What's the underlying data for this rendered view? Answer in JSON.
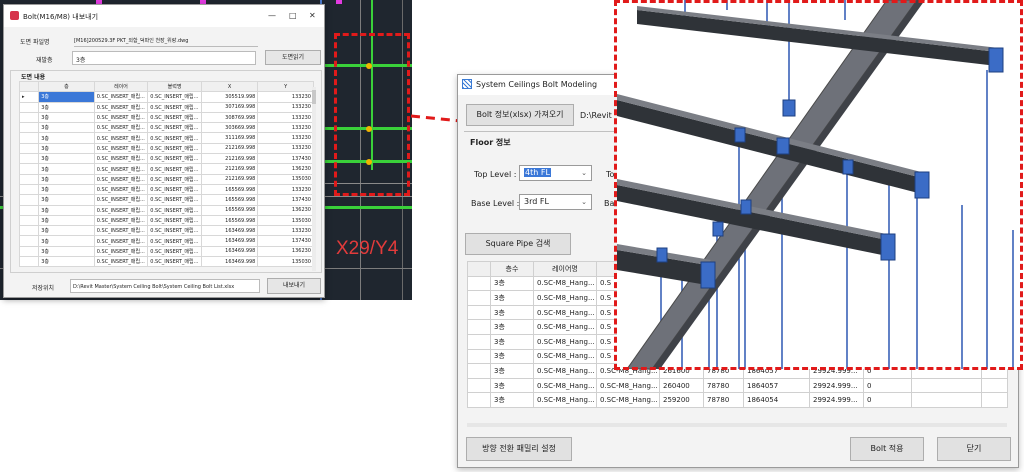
{
  "cad": {
    "label": "X29/Y4"
  },
  "export_window": {
    "title": "Bolt(M16/M8) 내보내기",
    "file_label": "도면 파일명",
    "file_value": "[M16]200529.3F PKT_외함_덕파인 천장_위랑.dwg",
    "floor_label": "재발층",
    "floor_value": "3층",
    "open_button": "도면읽기",
    "section_label": "도면 내용",
    "columns": [
      "층",
      "레이어",
      "블럭명",
      "X",
      "Y"
    ],
    "rows": [
      [
        "3층",
        "0.SC_INSERT_매립...",
        "0.SC_INSERT_매립...",
        "305519.998",
        "133230"
      ],
      [
        "3층",
        "0.SC_INSERT_매립...",
        "0.SC_INSERT_매립...",
        "307169.998",
        "133230"
      ],
      [
        "3층",
        "0.SC_INSERT_매립...",
        "0.SC_INSERT_매립...",
        "308769.998",
        "133230"
      ],
      [
        "3층",
        "0.SC_INSERT_매립...",
        "0.SC_INSERT_매립...",
        "303669.998",
        "133230"
      ],
      [
        "3층",
        "0.SC_INSERT_매립...",
        "0.SC_INSERT_매립...",
        "311169.998",
        "133230"
      ],
      [
        "3층",
        "0.SC_INSERT_매립...",
        "0.SC_INSERT_매립...",
        "212169.998",
        "133230"
      ],
      [
        "3층",
        "0.SC_INSERT_매립...",
        "0.SC_INSERT_매립...",
        "212169.998",
        "137430"
      ],
      [
        "3층",
        "0.SC_INSERT_매립...",
        "0.SC_INSERT_매립...",
        "212169.998",
        "136230"
      ],
      [
        "3층",
        "0.SC_INSERT_매립...",
        "0.SC_INSERT_매립...",
        "212169.998",
        "135030"
      ],
      [
        "3층",
        "0.SC_INSERT_매립...",
        "0.SC_INSERT_매립...",
        "165569.998",
        "133230"
      ],
      [
        "3층",
        "0.SC_INSERT_매립...",
        "0.SC_INSERT_매립...",
        "165569.998",
        "137430"
      ],
      [
        "3층",
        "0.SC_INSERT_매립...",
        "0.SC_INSERT_매립...",
        "165569.998",
        "136230"
      ],
      [
        "3층",
        "0.SC_INSERT_매립...",
        "0.SC_INSERT_매립...",
        "165569.998",
        "135030"
      ],
      [
        "3층",
        "0.SC_INSERT_매립...",
        "0.SC_INSERT_매립...",
        "163469.998",
        "133230"
      ],
      [
        "3층",
        "0.SC_INSERT_매립...",
        "0.SC_INSERT_매립...",
        "163469.998",
        "137430"
      ],
      [
        "3층",
        "0.SC_INSERT_매립...",
        "0.SC_INSERT_매립...",
        "163469.998",
        "136230"
      ],
      [
        "3층",
        "0.SC_INSERT_매립...",
        "0.SC_INSERT_매립...",
        "163469.998",
        "135030"
      ]
    ],
    "save_label": "저장위치",
    "save_path": "D:\\Revit Master\\System Ceiling Bolt\\System Ceiling Bolt List.xlsx",
    "export_button": "내보내기"
  },
  "model_window": {
    "title": "System Ceilings Bolt Modeling",
    "import_button": "Bolt 정보(xlsx) 가져오기",
    "path_text": "D:\\Revit",
    "floor_section": "Floor 정보",
    "top_level_label": "Top Level :",
    "top_level_value": "4th FL",
    "top_level_trailing": "To",
    "base_level_label": "Base Level :",
    "base_level_value": "3rd FL",
    "base_level_trailing": "Ba",
    "search_button": "Square Pipe 검색",
    "columns": [
      "층수",
      "레이어명",
      "블"
    ],
    "rows_short": [
      [
        "3층",
        "0.SC-M8_Hang...",
        "0.S"
      ],
      [
        "3층",
        "0.SC-M8_Hang...",
        "0.S"
      ],
      [
        "3층",
        "0.SC-M8_Hang...",
        "0.S"
      ],
      [
        "3층",
        "0.SC-M8_Hang...",
        "0.S"
      ],
      [
        "3층",
        "0.SC-M8_Hang...",
        "0.S"
      ],
      [
        "3층",
        "0.SC-M8_Hang...",
        "0.S"
      ]
    ],
    "rows_full": [
      [
        "3층",
        "0.SC-M8_Hang...",
        "0.SC-M8_Hang...",
        "261600",
        "78780",
        "1864057",
        "29924.999...",
        "0"
      ],
      [
        "3층",
        "0.SC-M8_Hang...",
        "0.SC-M8_Hang...",
        "260400",
        "78780",
        "1864057",
        "29924.999...",
        "0"
      ],
      [
        "3층",
        "0.SC-M8_Hang...",
        "0.SC-M8_Hang...",
        "259200",
        "78780",
        "1864054",
        "29924.999...",
        "0"
      ]
    ],
    "family_button": "방향 전환 패밀리 설정",
    "apply_button": "Bolt 적용",
    "close_button": "닫기"
  }
}
